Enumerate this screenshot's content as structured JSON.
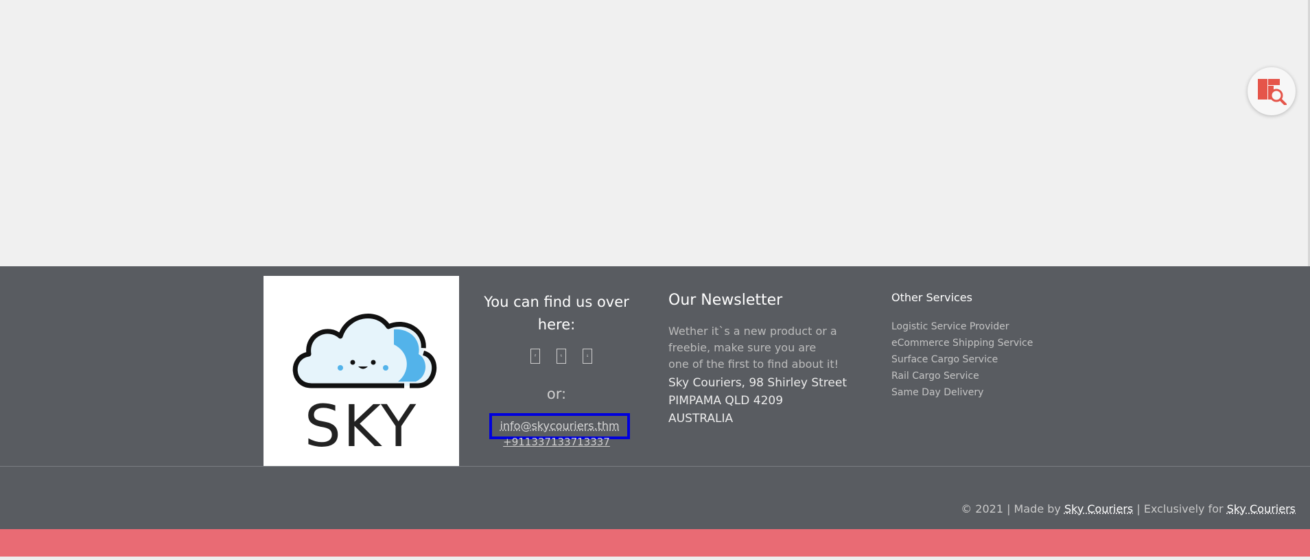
{
  "footer": {
    "logo": {
      "text": "SKY"
    },
    "contact": {
      "title": "You can find us over here:",
      "social_icons": [
        "facebook-icon",
        "twitter-icon",
        "instagram-icon"
      ],
      "or_label": "or:",
      "email": "info@skycouriers.thm",
      "phone": "+911337133713337"
    },
    "newsletter": {
      "title": "Our Newsletter",
      "text": "Wether it`s a new product or a freebie, make sure you are one of the first to find about it!",
      "address_line1": "Sky Couriers, 98 Shirley Street",
      "address_line2": "PIMPAMA QLD 4209",
      "address_line3": "AUSTRALIA"
    },
    "services": {
      "title": "Other Services",
      "items": [
        "Logistic Service Provider",
        "eCommerce Shipping Service",
        "Surface Cargo Service",
        "Rail Cargo Service",
        "Same Day Delivery"
      ]
    },
    "copyright": {
      "prefix": "© 2021 | Made by",
      "made_by_link": "Sky Couriers",
      "middle": "| Exclusively for",
      "for_link": "Sky Couriers"
    }
  },
  "colors": {
    "footer_bg": "#595c61",
    "accent_bar": "#e96b74",
    "fab_icon": "#e5554a",
    "focus_outline": "#0000dd"
  }
}
